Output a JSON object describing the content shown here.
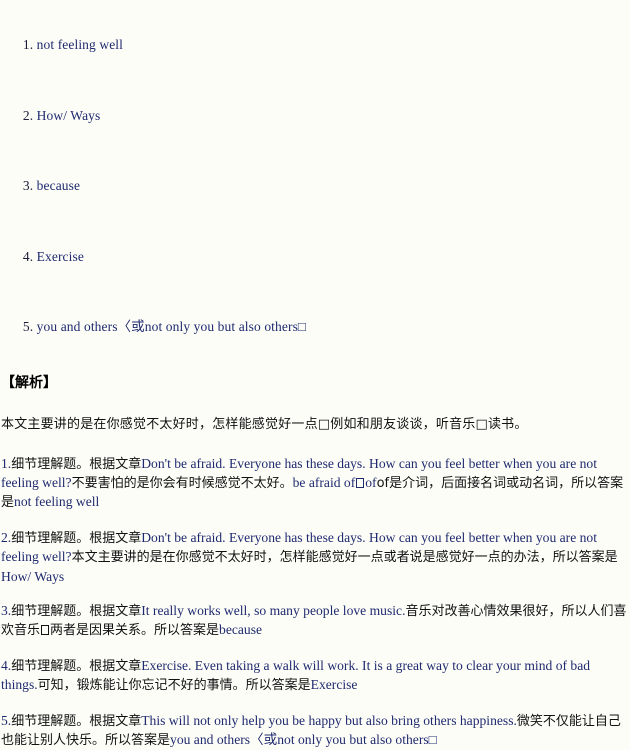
{
  "document": {
    "answers_label": "answers-list",
    "answers": [
      {
        "num": "1.",
        "text": "not feeling well"
      },
      {
        "num": "2.",
        "text": "How/ Ways"
      },
      {
        "num": "3.",
        "text": "because"
      },
      {
        "num": "4.",
        "text": "Exercise"
      },
      {
        "num": "5.",
        "text": "you and others〈或not only you but also others□"
      }
    ],
    "analysis_heading": "【解析】",
    "summary": "本文主要讲的是在你感觉不太好时，怎样能感觉好一点□例如和朋友谈谈，听音乐□读书。",
    "analysis_items": [
      {
        "num": "1.",
        "lead": "细节理解题。根据文章",
        "quote": "Don't be afraid. Everyone has these days. How can you feel better when you are not feeling well?",
        "explain_a": "不要害怕的是你会有时候感觉不太好。",
        "term": "be afraid of",
        "tofu_after_term": "□",
        "explain_b": "of是介词，后面接名词或动名词，所以答案是",
        "answer": "not feeling well"
      },
      {
        "num": "2.",
        "lead": "细节理解题。根据文章",
        "quote": "Don't be afraid. Everyone has these days. How can you feel better when you are not feeling well?",
        "explain_a": "本文主要讲的是在你感觉不太好时，怎样能感觉好一点或者说是感觉好一点的办法，所以答案是",
        "answer": "How/ Ways"
      },
      {
        "num": "3.",
        "lead": "细节理解题。根据文章",
        "quote": "It really works well, so many people love music.",
        "explain_a": "音乐对改善心情效果很好，所以人们喜欢音乐",
        "tofu_mid": "□",
        "explain_b": "两者是因果关系。所以答案是",
        "answer": "because"
      },
      {
        "num": "4.",
        "lead": "细节理解题。根据文章",
        "quote": "Exercise. Even taking a walk will work. It is a great way to clear your mind of bad things.",
        "explain_a": "可知，锻炼能让你忘记不好的事情。所以答案是",
        "answer": "Exercise"
      },
      {
        "num": "5.",
        "lead": "细节理解题。根据文章",
        "quote": "This will not only help you be happy but also bring others happiness.",
        "explain_a": "微笑不仅能让自己也能让别人快乐。所以答案是",
        "answer": "you and others〈或not only you but also others□"
      }
    ]
  },
  "colors": {
    "background": "#fdfdf8",
    "english_text": "#1f2a6e",
    "chinese_text": "#111111",
    "answer_text": "#1b1b3a"
  }
}
